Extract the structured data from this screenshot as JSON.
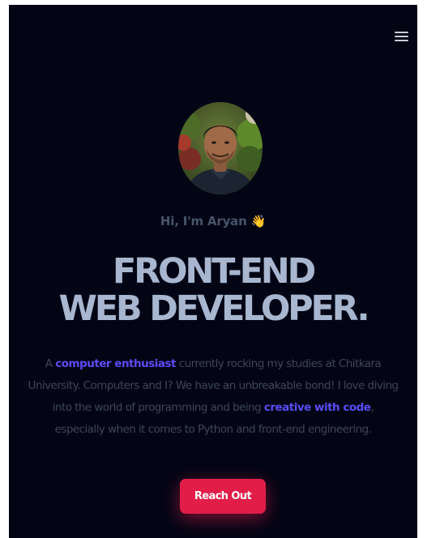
{
  "nav": {
    "menu_icon": "hamburger-menu-icon"
  },
  "hero": {
    "avatar_alt": "Profile photo",
    "greeting": "Hi, I'm Aryan",
    "wave_emoji": "👋",
    "headline_line1": "FRONT-END",
    "headline_line2": "WEB DEVELOPER.",
    "bio": {
      "part1": "A ",
      "highlight1": "computer enthusiast",
      "part2": " currently rocking my studies at Chitkara University. Computers and I? We have an unbreakable bond! I love diving into the world of programming and being ",
      "highlight2": "creative with code",
      "part3": ", especially when it comes to Python and front-end engineering."
    },
    "cta_label": "Reach Out"
  },
  "colors": {
    "background": "#030515",
    "headline": "#a8b7cf",
    "greeting": "#475569",
    "body_text": "#3c4658",
    "highlight": "#5b4cf5",
    "cta": "#e11d48"
  }
}
